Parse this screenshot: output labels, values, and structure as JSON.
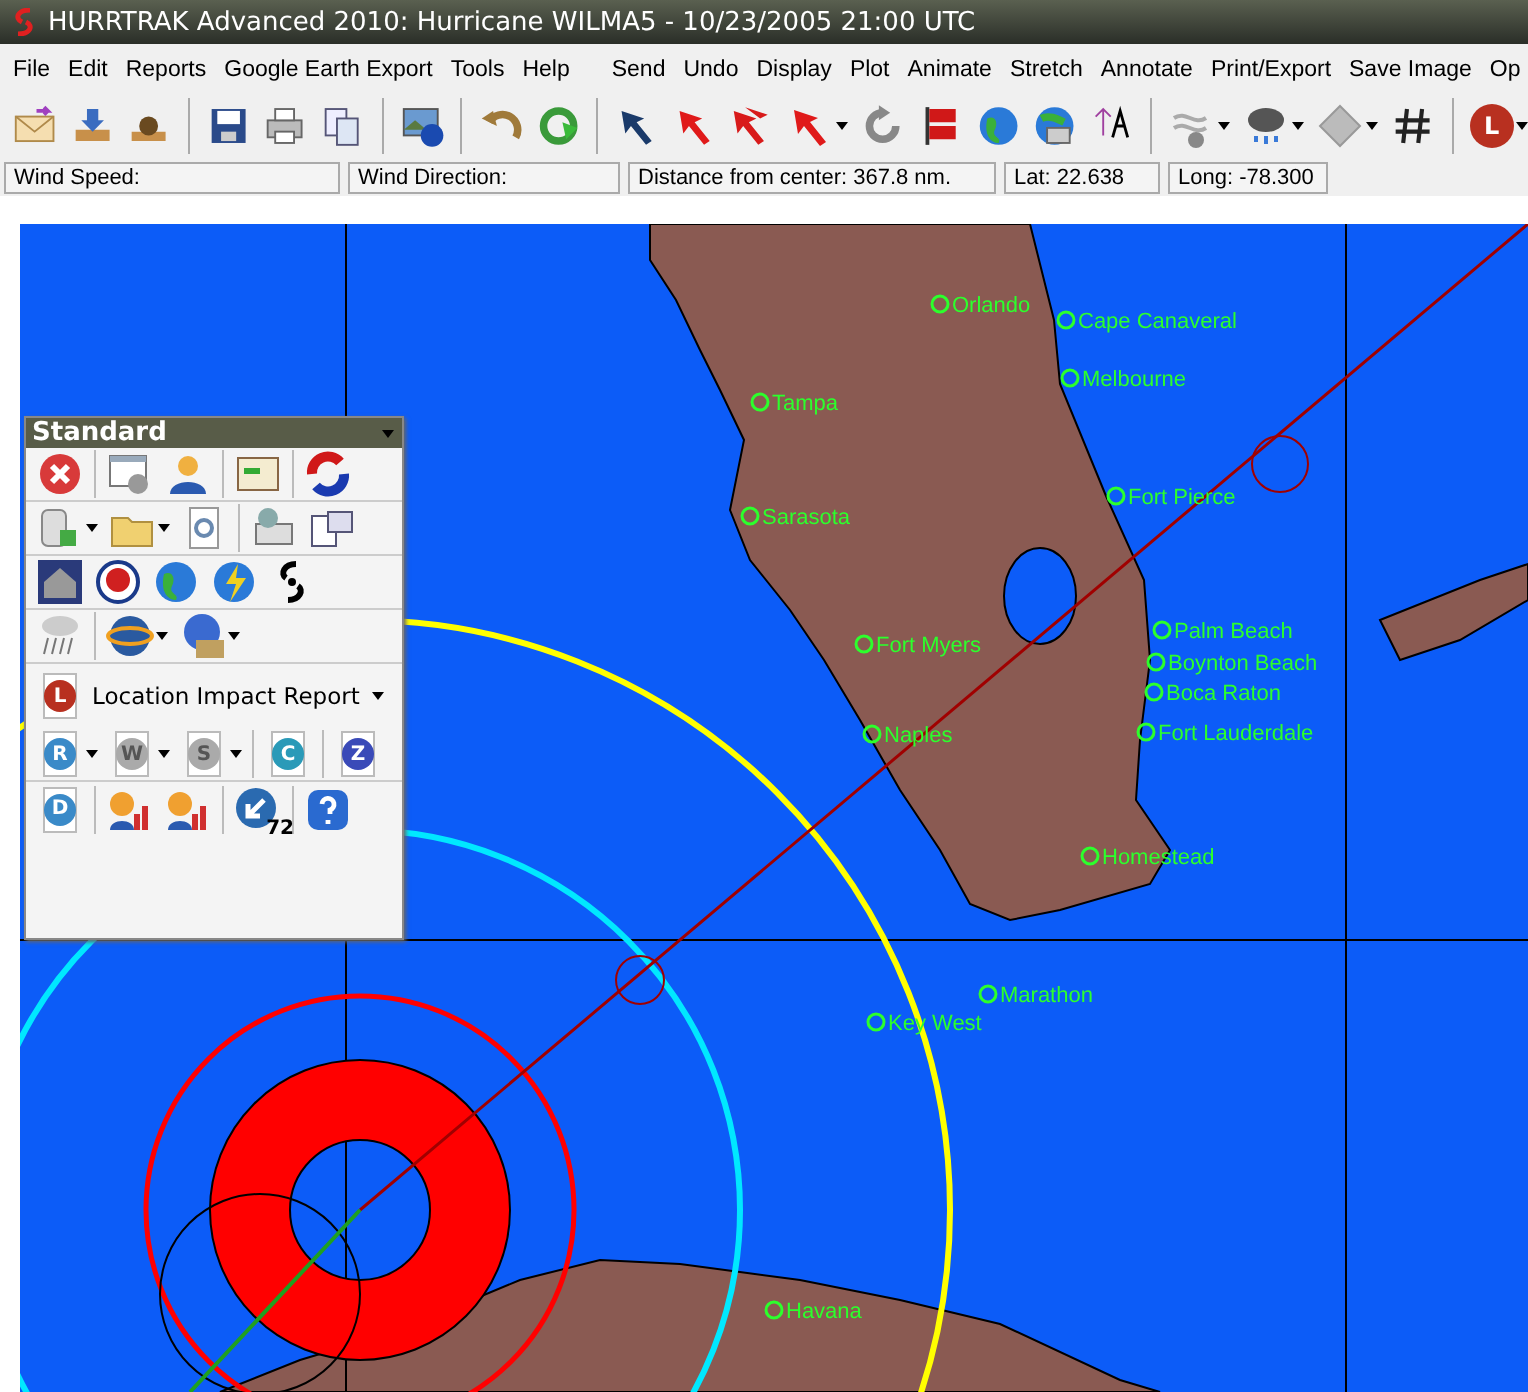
{
  "window": {
    "title": "HURRTRAK Advanced 2010: Hurricane WILMA5 - 10/23/2005 21:00 UTC"
  },
  "menu": {
    "left": [
      "File",
      "Edit",
      "Reports",
      "Google Earth Export",
      "Tools",
      "Help"
    ],
    "right": [
      "Send",
      "Undo",
      "Display",
      "Plot",
      "Animate",
      "Stretch",
      "Annotate",
      "Print/Export",
      "Save Image",
      "Op"
    ]
  },
  "toolbar": {
    "letter_icon": "L"
  },
  "status_bar": [
    "Wind Speed:",
    "Wind Direction:",
    "Distance from center: 367.8 nm.",
    "Lat: 22.638",
    "Long: -78.300"
  ],
  "panel": {
    "title": "Standard",
    "report_button": "Location Impact Report",
    "report_letter": "L",
    "letter_icons": [
      "R",
      "W",
      "S",
      "C",
      "Z",
      "D"
    ],
    "badge": "72"
  },
  "map": {
    "cities": [
      "Orlando",
      "Cape Canaveral",
      "Melbourne",
      "Tampa",
      "Fort Pierce",
      "Sarasota",
      "Palm Beach",
      "Fort Myers",
      "Boynton Beach",
      "Boca Raton",
      "Naples",
      "Fort Lauderdale",
      "Homestead",
      "Marathon",
      "Key West",
      "Havana"
    ]
  }
}
